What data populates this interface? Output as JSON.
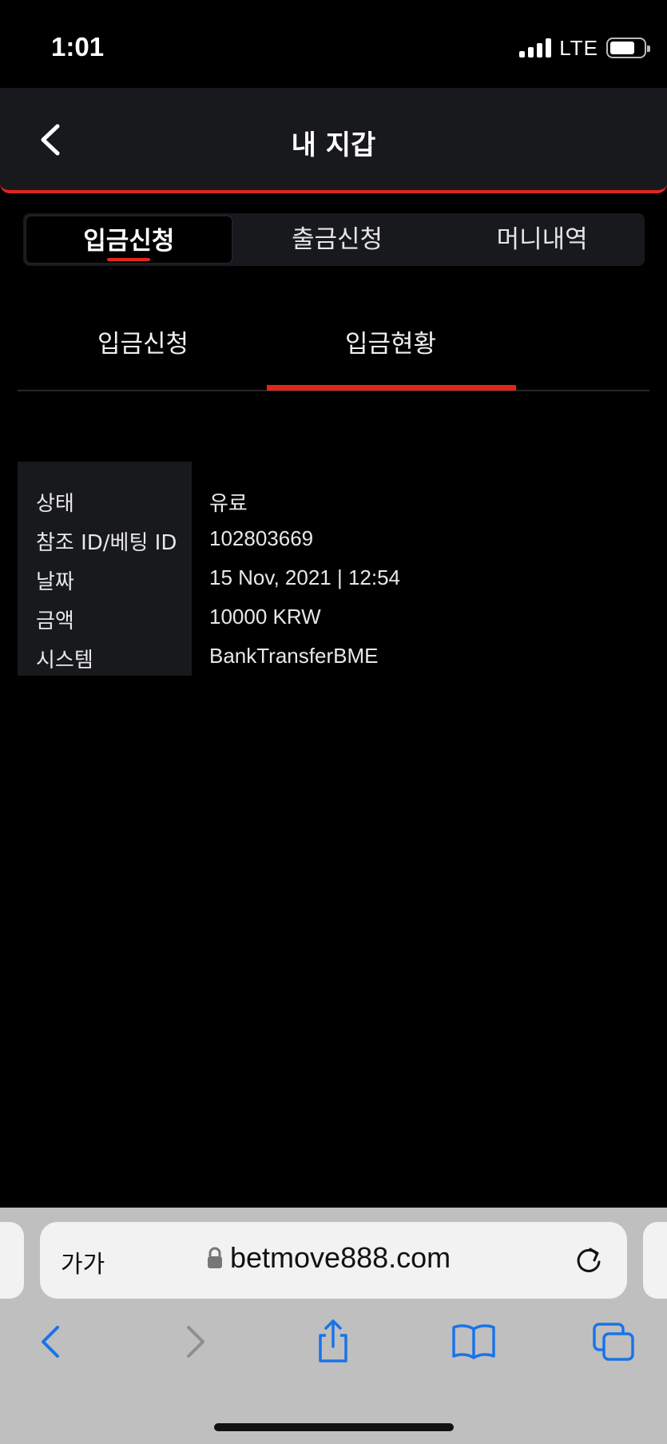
{
  "status_bar": {
    "time": "1:01",
    "network": "LTE"
  },
  "header": {
    "title": "내 지갑"
  },
  "main_tabs": [
    {
      "label": "입금신청",
      "active": true
    },
    {
      "label": "출금신청",
      "active": false
    },
    {
      "label": "머니내역",
      "active": false
    }
  ],
  "sub_tabs": [
    {
      "label": "입금신청",
      "active": false
    },
    {
      "label": "입금현황",
      "active": true
    }
  ],
  "deposit_status": {
    "rows": [
      {
        "label": "상태",
        "value": "유료"
      },
      {
        "label": "참조 ID/베팅 ID",
        "value": "102803669"
      },
      {
        "label": "날짜",
        "value": "15 Nov, 2021 | 12:54"
      },
      {
        "label": "금액",
        "value": "10000 KRW"
      },
      {
        "label": "시스템",
        "value": "BankTransferBME"
      }
    ]
  },
  "browser": {
    "text_size_label": "가가",
    "url": "betmove888.com"
  },
  "colors": {
    "accent": "#e0261c",
    "header_bg": "#18191d",
    "page_bg": "#000000"
  }
}
